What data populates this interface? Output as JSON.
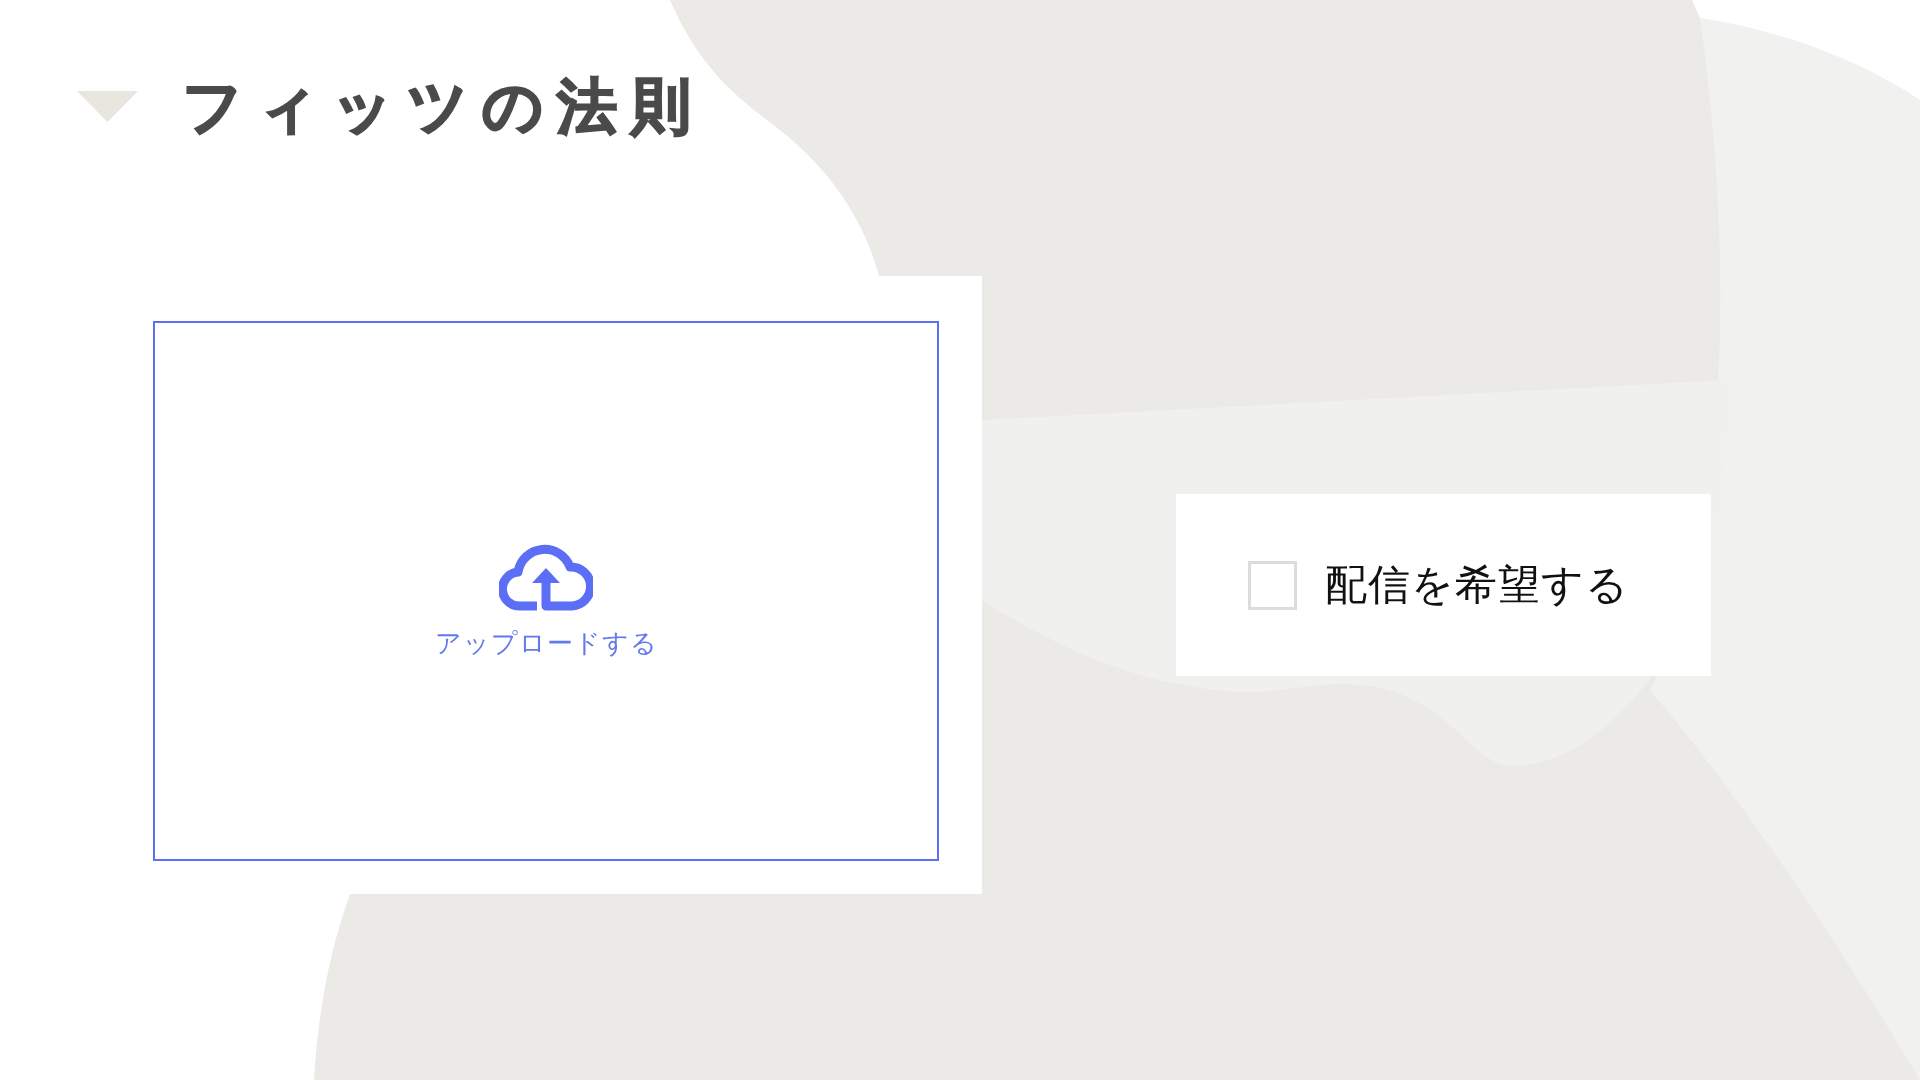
{
  "title": {
    "text": "フィッツの法則"
  },
  "upload": {
    "label": "アップロードする"
  },
  "checkbox": {
    "label": "配信を希望する",
    "checked": false
  }
}
